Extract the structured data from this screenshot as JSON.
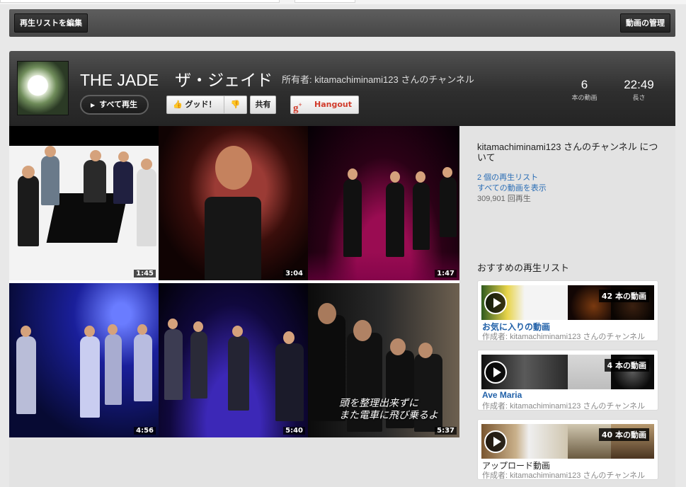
{
  "toolbar": {
    "edit_playlist": "再生リストを編集",
    "manage_videos": "動画の管理"
  },
  "playlist": {
    "title": "THE JADE　ザ・ジェイド",
    "owner_text": "所有者: kitamachiminami123 さんのチャンネル",
    "play_all": "すべて再生",
    "like_label": "グッド！",
    "share_label": "共有",
    "hangout_label": "Hangout",
    "video_count": "6",
    "video_count_label": "本の動画",
    "duration": "22:49",
    "duration_label": "長さ"
  },
  "videos": [
    {
      "duration": "1:45"
    },
    {
      "duration": "3:04"
    },
    {
      "duration": "1:47"
    },
    {
      "duration": "4:56"
    },
    {
      "duration": "5:40"
    },
    {
      "duration": "5:37",
      "subtitle_line1": "頭を整理出来ずに",
      "subtitle_line2": "また電車に飛び乗るよ"
    }
  ],
  "sidebar": {
    "about_title": "kitamachiminami123 さんのチャンネル について",
    "playlists_link": "2 個の再生リスト",
    "all_videos_link": "すべての動画を表示",
    "views": "309,901 回再生",
    "recommended_title": "おすすめの再生リスト",
    "cards": [
      {
        "count": "42 本の動画",
        "title": "お気に入りの動画",
        "by": "作成者: kitamachiminami123 さんのチャンネル"
      },
      {
        "count": "4 本の動画",
        "title": "Ave Maria",
        "by": "作成者: kitamachiminami123 さんのチャンネル"
      },
      {
        "count": "40 本の動画",
        "title": "アップロード動画",
        "by": "作成者: kitamachiminami123 さんのチャンネル"
      }
    ]
  },
  "colors": {
    "header_bg": "#2e2e2e",
    "link": "#2a6db5",
    "hangout_red": "#d13b2b"
  }
}
